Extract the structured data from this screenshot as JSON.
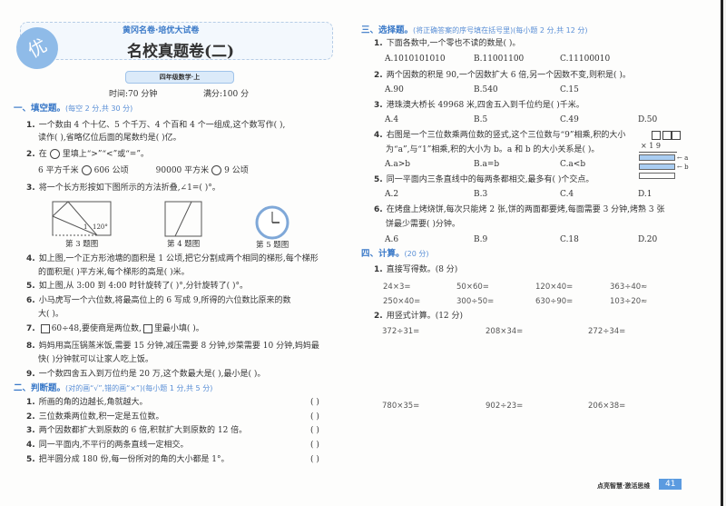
{
  "header": {
    "series": "黄冈名卷·培优大试卷",
    "badge": "优",
    "title": "名校真题卷(二)",
    "subtitle": "四年级数学·上",
    "time": "时间:70 分钟",
    "score": "满分:100 分"
  },
  "sec1": {
    "title": "一、填空题。",
    "note": "(每空 2 分,共 30 分)",
    "q1a": "一个数由 4 个十亿、5 个千万、4 个百和 4 个一组成,这个数写作(                    ),",
    "q1b": "读作(                              ),省略亿位后面的尾数约是(      )亿。",
    "q2a": "在",
    "q2b": "里填上“>”“<”或“=”。",
    "q2c1": "6 平方千米",
    "q2c2": "606 公顷",
    "q2c3": "90000 平方米",
    "q2c4": "9 公顷",
    "q3": "将一个长方形按如下图所示的方法折叠,∠1=(          )°。",
    "fig_angle": "120°",
    "fig_one": "1",
    "cap3": "第 3 题图",
    "cap4": "第 4 题图",
    "cap5": "第 5 题图",
    "q4a": "如上图,一个正方形池塘的面积是 1 公顷,把它分割成两个相同的梯形,每个梯形",
    "q4b": "的面积是(       )平方米,每个梯形的高是(       )米。",
    "q5": "如上图,从 3:00 到 4:00 时针旋转了(            )°,分针旋转了(            )°。",
    "q6a": "小马虎写一个六位数,将最高位上的 6 写成 9,所得的六位数比原来的数",
    "q6b": "大(          )。",
    "q7a": "60÷48,要使商是两位数,",
    "q7b": "里最小填(          )。",
    "q8a": "妈妈用高压锅蒸米饭,需要 15 分钟,减压需要 8 分钟,炒菜需要 10 分钟,妈妈最",
    "q8b": "快(          )分钟就可以让家人吃上饭。",
    "q9": "一个数四舍五入到万位约是 20 万,这个数最大是(              ),最小是(              )。"
  },
  "sec2": {
    "title": "二、判断题。",
    "note": "(对的画“√”,错的画“×”)(每小题 1 分,共 5 分)",
    "paren": "(      )",
    "items": [
      "所画的角的边越长,角就越大。",
      "三位数乘两位数,积一定是五位数。",
      "两个因数都扩大到原数的 6 倍,积就扩大到原数的 12 倍。",
      "同一平面内,不平行的两条直线一定相交。",
      "把半圆分成 180 份,每一份所对的角的大小都是 1°。"
    ]
  },
  "sec3": {
    "title": "三、选择题。",
    "note": "(将正确答案的序号填在括号里)(每小题 2 分,共 12 分)",
    "q1": "下面各数中,一个零也不读的数是(       )。",
    "q1o": [
      "A.1010101010",
      "B.11001100",
      "C.11100010"
    ],
    "q2": "两个因数的积是 90,一个因数扩大 6 倍,另一个因数不变,则积是(       )。",
    "q2o": [
      "A.90",
      "B.540",
      "C.15"
    ],
    "q3": "港珠澳大桥长 49968 米,四舍五入到千位约是(       )千米。",
    "q3o": [
      "A.4",
      "B.5",
      "C.49",
      "D.50"
    ],
    "q4a": "右图是一个三位数乘两位数的竖式,这个三位数与“9”相乘,积的大小",
    "q4b": "为“a”,与“1”相乘,积的大小为 b。a 和 b 的大小关系是(       )。",
    "q4o": [
      "A.a>b",
      "B.a=b",
      "C.a<b"
    ],
    "fig_mult": "× 1 9",
    "fig_a": "← a",
    "fig_b": "← b",
    "q5": "同一平面内三条直线中的每两条都相交,最多有(       )个交点。",
    "q5o": [
      "A.2",
      "B.3",
      "C.4",
      "D.1"
    ],
    "q6a": "在烤盘上烤烧饼,每次只能烤 2 张,饼的两面都要烤,每面需要 3 分钟,烤熟 3 张",
    "q6b": "饼最少需要(       )分钟。",
    "q6o": [
      "A.6",
      "B.9",
      "C.18",
      "D.20"
    ]
  },
  "sec4": {
    "title": "四、计算。",
    "note": "(20 分)",
    "p1": "直接写得数。(8 分)",
    "row1": [
      "24×3=",
      "50×60=",
      "120×40=",
      "363÷40≈"
    ],
    "row2": [
      "250×40=",
      "300÷50=",
      "630÷90=",
      "103÷20≈"
    ],
    "p2": "用竖式计算。(12 分)",
    "row3": [
      "372÷31=",
      "208×34=",
      "272÷34="
    ],
    "row4": [
      "780×35=",
      "902÷23=",
      "206×38="
    ]
  },
  "footer": {
    "slogan": "点亮智慧·激活思维",
    "page": "41"
  },
  "colors": {
    "accent": "#3a79c8",
    "light": "#a9cdf2"
  }
}
